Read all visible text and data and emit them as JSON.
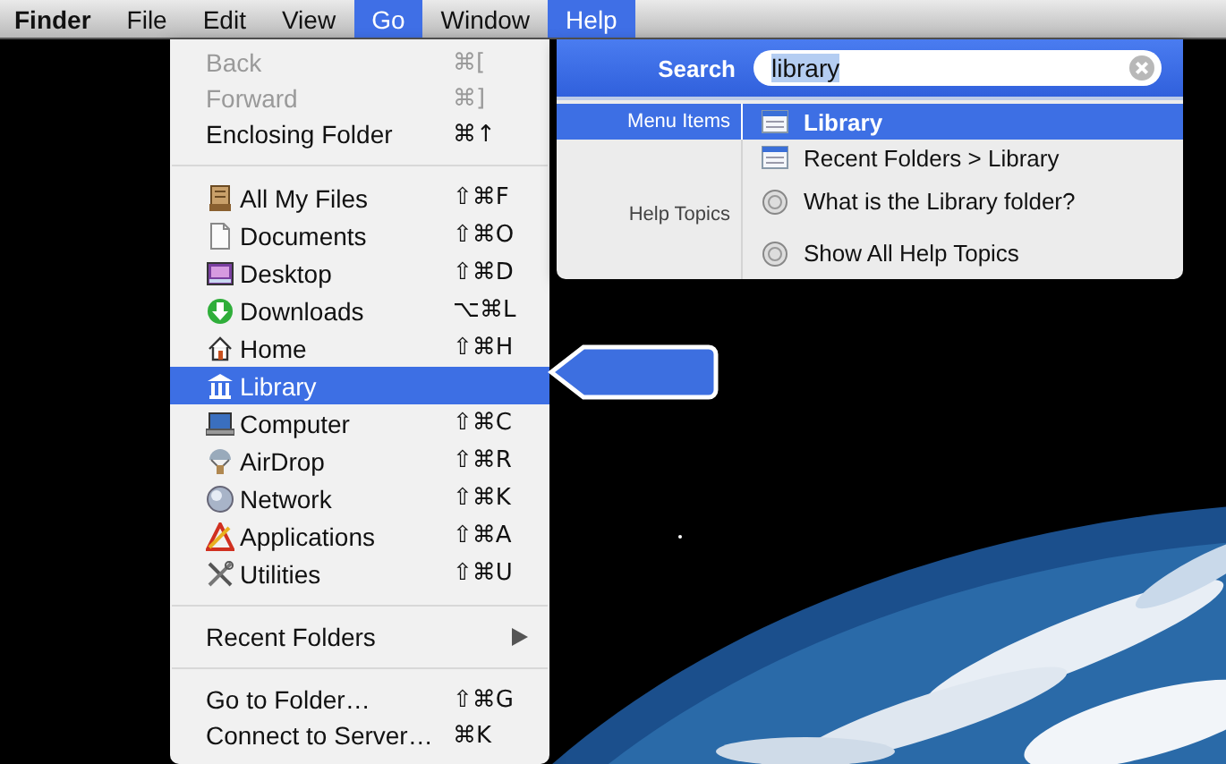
{
  "menubar": [
    {
      "label": "Finder",
      "kind": "app",
      "selected": false
    },
    {
      "label": "File",
      "kind": "menu",
      "selected": false
    },
    {
      "label": "Edit",
      "kind": "menu",
      "selected": false
    },
    {
      "label": "View",
      "kind": "menu",
      "selected": false
    },
    {
      "label": "Go",
      "kind": "menu",
      "selected": true
    },
    {
      "label": "Window",
      "kind": "menu",
      "selected": false
    },
    {
      "label": "Help",
      "kind": "menu",
      "selected": true
    }
  ],
  "go_menu": {
    "sections": [
      [
        {
          "label": "Back",
          "shortcut": "⌘[",
          "disabled": true,
          "selected": false
        },
        {
          "label": "Forward",
          "shortcut": "⌘]",
          "disabled": true,
          "selected": false
        },
        {
          "label": "Enclosing Folder",
          "shortcut": "⌘↑",
          "disabled": false,
          "selected": false
        }
      ],
      [
        {
          "label": "All My Files",
          "shortcut": "⇧⌘F",
          "kind": "files",
          "disabled": false,
          "selected": false
        },
        {
          "label": "Documents",
          "shortcut": "⇧⌘O",
          "kind": "document",
          "disabled": false,
          "selected": false
        },
        {
          "label": "Desktop",
          "shortcut": "⇧⌘D",
          "kind": "desktop",
          "disabled": false,
          "selected": false
        },
        {
          "label": "Downloads",
          "shortcut": "⌥⌘L",
          "kind": "download",
          "disabled": false,
          "selected": false
        },
        {
          "label": "Home",
          "shortcut": "⇧⌘H",
          "kind": "home",
          "disabled": false,
          "selected": false
        },
        {
          "label": "Library",
          "kind": "library",
          "disabled": false,
          "selected": true
        },
        {
          "label": "Computer",
          "shortcut": "⇧⌘C",
          "kind": "computer",
          "disabled": false,
          "selected": false
        },
        {
          "label": "AirDrop",
          "shortcut": "⇧⌘R",
          "kind": "airdrop",
          "disabled": false,
          "selected": false
        },
        {
          "label": "Network",
          "shortcut": "⇧⌘K",
          "kind": "network",
          "disabled": false,
          "selected": false
        },
        {
          "label": "Applications",
          "shortcut": "⇧⌘A",
          "kind": "applications",
          "disabled": false,
          "selected": false
        },
        {
          "label": "Utilities",
          "shortcut": "⇧⌘U",
          "kind": "utilities",
          "disabled": false,
          "selected": false
        }
      ],
      [
        {
          "label": "Recent Folders",
          "submenu": true,
          "disabled": false,
          "selected": false
        }
      ],
      [
        {
          "label": "Go to Folder…",
          "shortcut": "⇧⌘G",
          "disabled": false,
          "selected": false
        },
        {
          "label": "Connect to Server…",
          "shortcut": "⌘K",
          "disabled": false,
          "selected": false
        }
      ]
    ]
  },
  "help": {
    "search_label": "Search",
    "query": "library",
    "query_selected": true,
    "groups": [
      {
        "label": "Menu Items",
        "results": [
          {
            "label": "Library",
            "kind": "menu",
            "selected": true
          },
          {
            "label": "Recent Folders > Library",
            "kind": "menu",
            "selected": false
          }
        ]
      },
      {
        "label": "Help Topics",
        "results": [
          {
            "label": "What is the Library folder?",
            "kind": "help",
            "selected": false
          },
          {
            "label": "Show All Help Topics",
            "kind": "help",
            "selected": false
          }
        ]
      }
    ]
  }
}
